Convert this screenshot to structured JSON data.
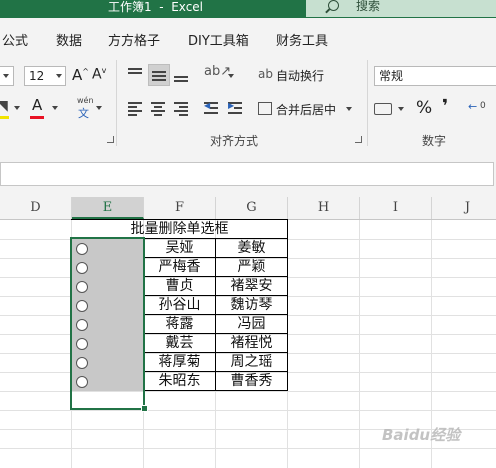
{
  "window": {
    "title": "工作簿1  -  Excel",
    "search_label": "搜索"
  },
  "tabs": [
    "公式",
    "数据",
    "方方格子",
    "DIY工具箱",
    "财务工具"
  ],
  "ribbon": {
    "font_size": "12",
    "wrap_text": "自动换行",
    "merge_center": "合并后居中",
    "number_format": "常规",
    "alignment_group": "对齐方式",
    "number_group": "数字",
    "pinyin_top": "wén",
    "pinyin_bottom": "文",
    "percent": "%",
    "comma": "❜"
  },
  "icons": {
    "grow_font": "A^",
    "shrink_font": "Av",
    "font_color": "A",
    "fill_color": "paint-bucket-icon",
    "text_rotate": "ab-rotate-icon"
  },
  "grid": {
    "columns": [
      "D",
      "E",
      "F",
      "G",
      "H",
      "I",
      "J"
    ],
    "active_column": "E",
    "header_title": "批量删除单选框",
    "rows": [
      [
        "吴娅",
        "姜敏"
      ],
      [
        "严梅香",
        "严颖"
      ],
      [
        "曹贞",
        "褚翠安"
      ],
      [
        "孙谷山",
        "魏访琴"
      ],
      [
        "蒋露",
        "冯园"
      ],
      [
        "戴芸",
        "褚程悦"
      ],
      [
        "蒋厚菊",
        "周之瑶"
      ],
      [
        "朱昭东",
        "曹香秀"
      ]
    ],
    "radio_count": 8
  },
  "watermark": "Baidu经验",
  "colors": {
    "accent": "#217346",
    "ribbon_bg": "#f3f3f3",
    "font_red": "#e81123"
  }
}
